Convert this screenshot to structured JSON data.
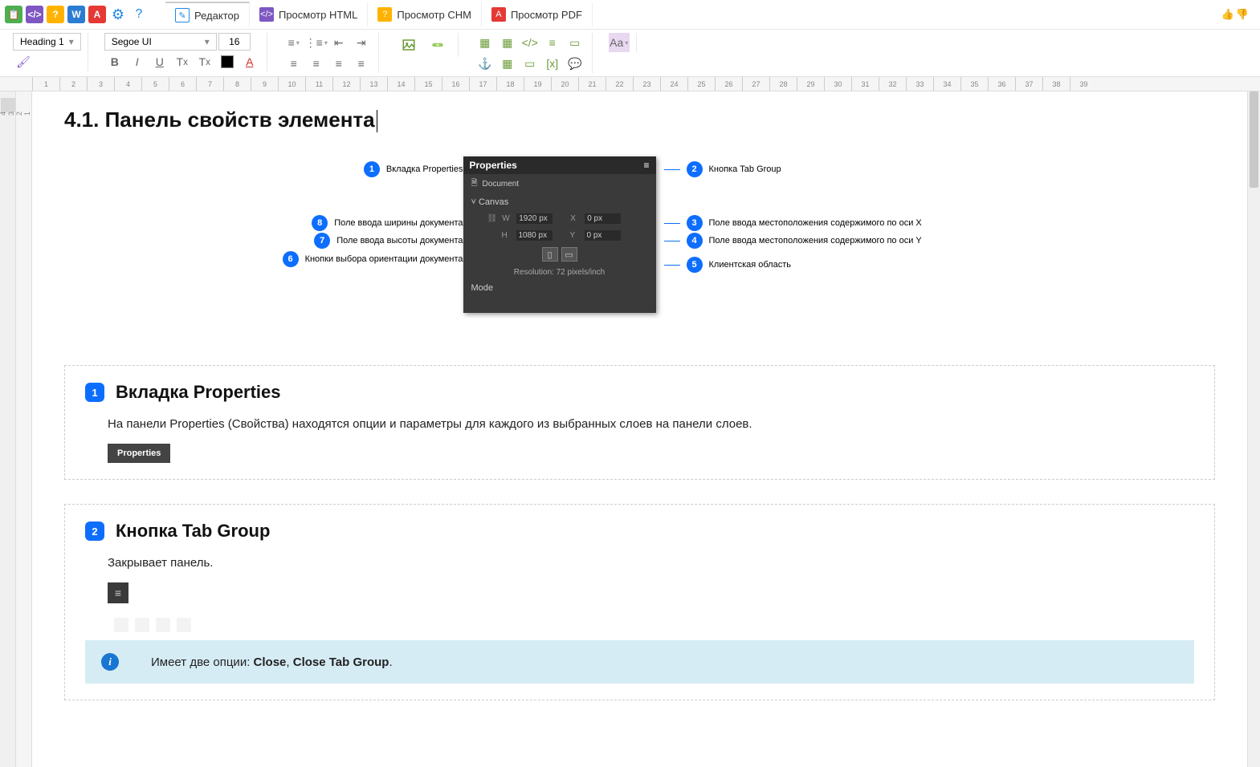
{
  "tabs": {
    "editor": "Редактор",
    "html": "Просмотр HTML",
    "chm": "Просмотр CHM",
    "pdf": "Просмотр PDF"
  },
  "ribbon": {
    "style": "Heading 1",
    "font": "Segoe UI",
    "size": "16"
  },
  "doc": {
    "title": "4.1. Панель свойств элемента"
  },
  "panel": {
    "title": "Properties",
    "doc": "Document",
    "canvas": "Canvas",
    "w_lbl": "W",
    "w_val": "1920 px",
    "h_lbl": "H",
    "h_val": "1080 px",
    "x_lbl": "X",
    "x_val": "0 px",
    "y_lbl": "Y",
    "y_val": "0 px",
    "res": "Resolution: 72 pixels/inch",
    "mode": "Mode"
  },
  "callouts": {
    "c1": "Вкладка Properties",
    "c2": "Кнопка Tab Group",
    "c3": "Поле ввода местоположения содержимого по оси X",
    "c4": "Поле ввода местоположения содержимого по оси Y",
    "c5": "Клиентская область",
    "c6": "Кнопки выбора ориентации документа",
    "c7": "Поле ввода высоты документа",
    "c8": "Поле ввода ширины документа"
  },
  "sections": {
    "s1": {
      "num": "1",
      "title": "Вкладка Properties",
      "body": "На панели Properties (Свойства) находятся опции и параметры для каждого из выбранных слоев на панели слоев.",
      "chip": "Properties"
    },
    "s2": {
      "num": "2",
      "title": "Кнопка Tab Group",
      "body": "Закрывает панель.",
      "info_pre": "Имеет две опции: ",
      "info_b1": "Close",
      "info_sep": ", ",
      "info_b2": "Close Tab Group",
      "info_dot": "."
    }
  }
}
